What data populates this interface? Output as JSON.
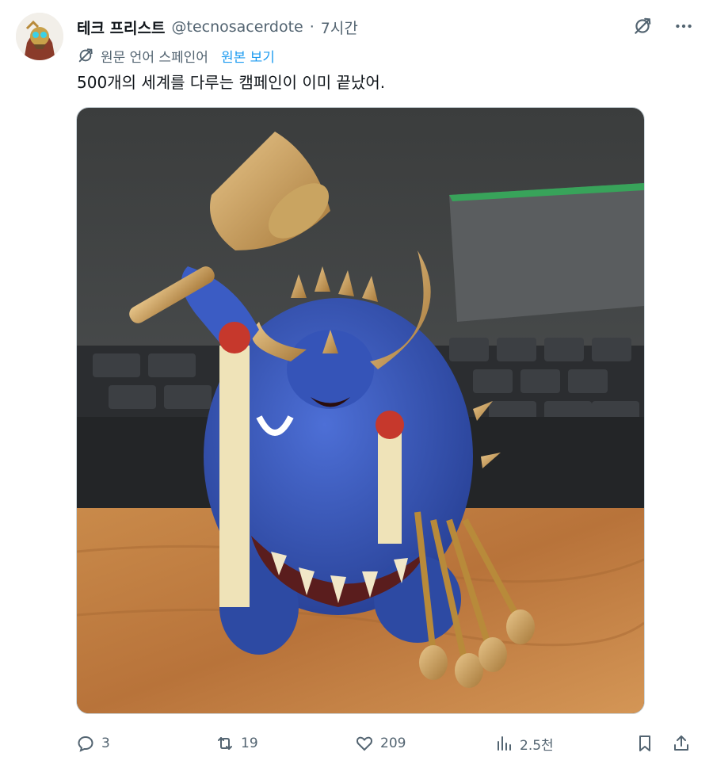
{
  "tweet": {
    "author_name": "테크 프리스트",
    "handle": "@tecnosacerdote",
    "separator": "·",
    "time": "7시간",
    "translated_note": "원문 언어 스페인어",
    "show_original": "원본 보기",
    "text": "500개의 세계를 다루는 캠페인이 이미 끝났어."
  },
  "icons": {
    "translate": "translate-icon",
    "more": "more-icon",
    "reply": "reply-icon",
    "retweet": "retweet-icon",
    "like": "like-icon",
    "views": "views-icon",
    "bookmark": "bookmark-icon",
    "share": "share-icon"
  },
  "actions": {
    "replies": "3",
    "retweets": "19",
    "likes": "209",
    "views": "2.5천"
  },
  "colors": {
    "text_primary": "#0f1419",
    "text_secondary": "#536471",
    "link": "#1d9bf0"
  }
}
